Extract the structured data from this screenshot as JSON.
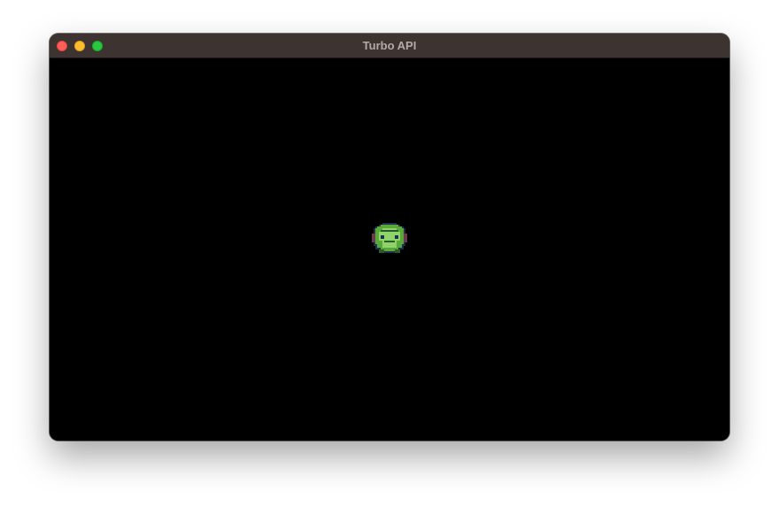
{
  "window": {
    "title": "Turbo API",
    "controls": {
      "close": "close-button",
      "minimize": "minimize-button",
      "zoom": "zoom-button"
    }
  },
  "canvas": {
    "background": "#000000",
    "sprite": {
      "name": "green-creature-sprite",
      "colors": [
        "#8fd46a",
        "#5aa83a",
        "#2c5a2a",
        "#1e2f4a",
        "#6b3a4a"
      ]
    }
  }
}
